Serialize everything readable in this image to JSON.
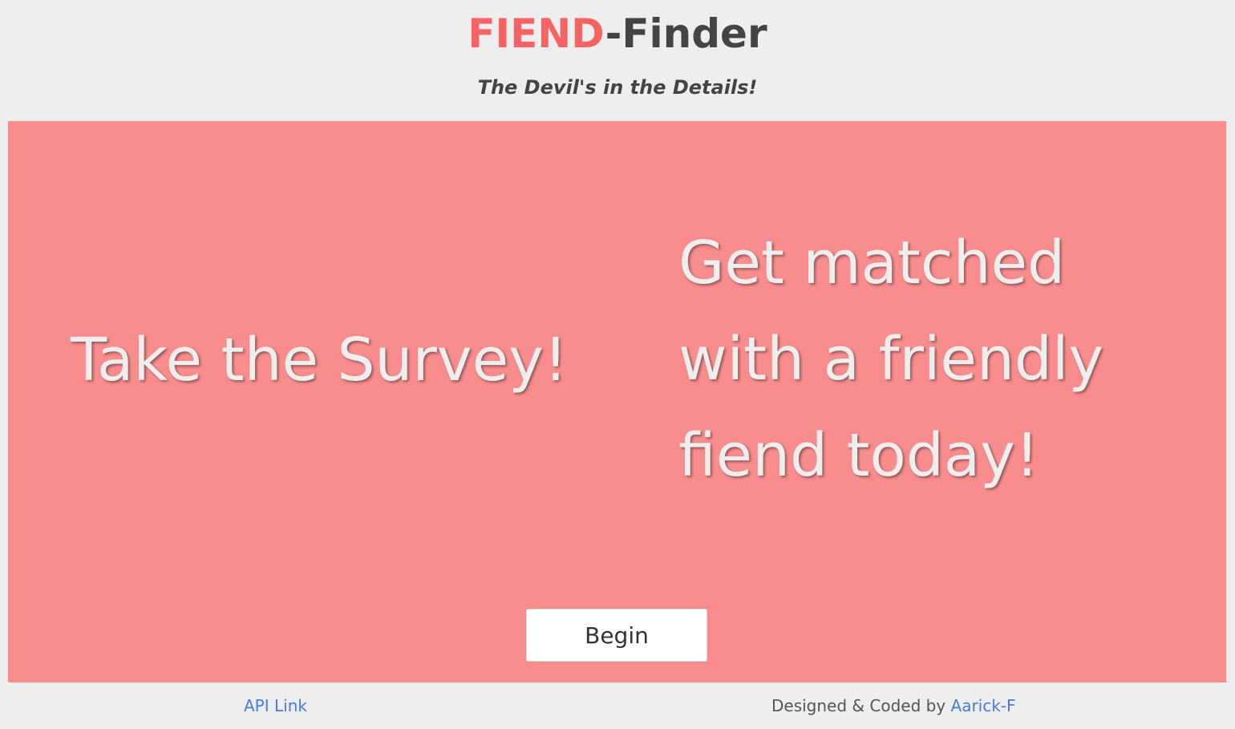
{
  "header": {
    "title_accent": "FIEND",
    "title_rest": "-Finder",
    "subtitle": "The Devil's in the Details!"
  },
  "hero": {
    "left_text": "Take the Survey!",
    "right_line1": "Get matched",
    "right_line2": "with a friendly",
    "right_line3": "fiend today!",
    "begin_label": "Begin"
  },
  "footer": {
    "api_link": "API Link",
    "credit_prefix": "Designed & Coded by ",
    "credit_link": "Aarick-F"
  },
  "colors": {
    "accent": "#f76363",
    "hero_bg": "#f98d8d",
    "link": "#4b7bd8",
    "page_bg": "#eeeeee"
  }
}
